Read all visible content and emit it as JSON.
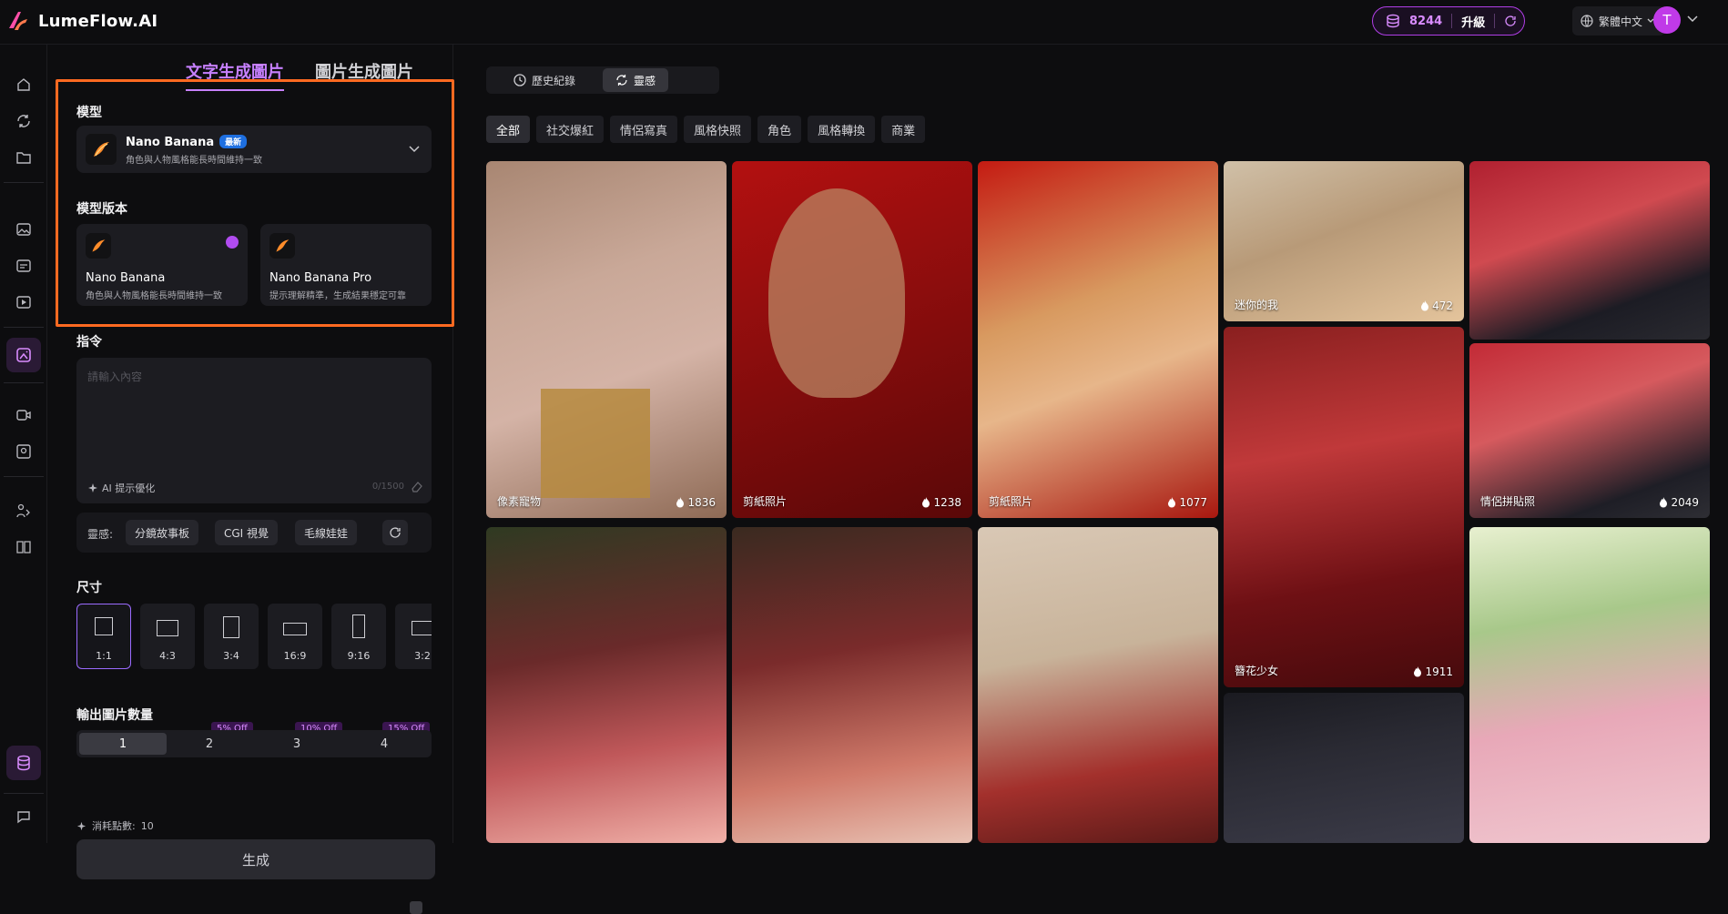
{
  "app": {
    "name": "LumeFlow",
    "suffix": ".AI"
  },
  "header": {
    "credits": "8244",
    "upgrade_label": "升級",
    "language": "繁體中文",
    "avatar_initial": "T",
    "accent": "#b03ee6"
  },
  "sidebar": {
    "icons": [
      "home-icon",
      "sync-icon",
      "folder-icon",
      "image-icon",
      "image-edit-icon",
      "image-play-icon",
      "image-generate-icon",
      "video-icon",
      "image-frame-icon",
      "people-icon",
      "book-icon",
      "database-icon",
      "chat-icon"
    ]
  },
  "panel": {
    "tabs": [
      "文字生成圖片",
      "圖片生成圖片"
    ],
    "model_label": "模型",
    "model": {
      "name": "Nano Banana",
      "badge": "最新",
      "desc": "角色與人物風格能長時間維持一致"
    },
    "version_label": "模型版本",
    "versions": [
      {
        "name": "Nano Banana",
        "desc": "角色與人物風格能長時間維持一致",
        "selected": true
      },
      {
        "name": "Nano Banana Pro",
        "desc": "提示理解精準，生成結果穩定可靠",
        "selected": false
      }
    ],
    "prompt_label": "指令",
    "prompt_placeholder": "請輸入內容",
    "ai_optimize": "AI 提示優化",
    "char_count": "0/1500",
    "inspiration_label": "靈感:",
    "inspiration_chips": [
      "分鏡故事板",
      "CGI 視覺",
      "毛線娃娃"
    ],
    "size_label": "尺寸",
    "sizes": [
      "1:1",
      "4:3",
      "3:4",
      "16:9",
      "9:16",
      "3:2"
    ],
    "quantity_label": "輸出圖片數量",
    "quantities": [
      "1",
      "2",
      "3",
      "4"
    ],
    "discounts": [
      "5% Off",
      "10% Off",
      "15% Off"
    ],
    "cost_label": "消耗點數:",
    "cost_value": "10",
    "generate_label": "生成"
  },
  "gallery": {
    "segments": [
      "歷史紀錄",
      "靈感"
    ],
    "filters": [
      "全部",
      "社交爆紅",
      "情侶寫真",
      "風格快照",
      "角色",
      "風格轉換",
      "商業"
    ],
    "cards": [
      {
        "title": "像素寵物",
        "likes": "1836"
      },
      {
        "title": "剪紙照片",
        "likes": "1238"
      },
      {
        "title": "剪紙照片",
        "likes": "1077"
      },
      {
        "title": "迷你的我",
        "likes": "472"
      },
      {
        "title": "情侶拼貼照",
        "likes": "2049"
      },
      {
        "title": "簪花少女",
        "likes": "1911"
      },
      {
        "title": "",
        "likes": ""
      },
      {
        "title": "",
        "likes": ""
      },
      {
        "title": "",
        "likes": ""
      },
      {
        "title": "",
        "likes": ""
      },
      {
        "title": "",
        "likes": ""
      },
      {
        "title": "",
        "likes": ""
      }
    ]
  }
}
